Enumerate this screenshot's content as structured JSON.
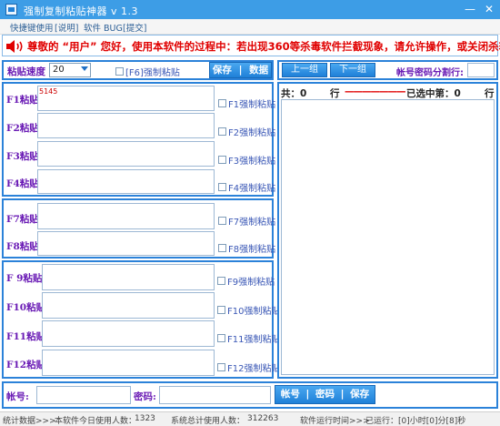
{
  "window": {
    "title": "强制复制粘贴神器 v 1.3",
    "controls": {
      "minimize": "—",
      "close": "✕"
    }
  },
  "menu": {
    "items": [
      "快捷键使用",
      "[说明]",
      "软件 BUG",
      "[提交]"
    ]
  },
  "notice": {
    "icon": "speaker-icon",
    "text": "尊敬的 “用户” 您好，使用本软件的过程中：若出现360等杀毒软件拦截现象，请允许操作，或关闭杀软！"
  },
  "speed": {
    "label": "粘贴速度",
    "value": "20",
    "force_label": "[F6]强制粘贴"
  },
  "toolbar": {
    "save": "保存",
    "data": "数据",
    "prev": "上一组",
    "next": "下一组",
    "separator_label": "帐号密码分割行:"
  },
  "paste_rows_group1": [
    {
      "label": "F1粘贴",
      "value": "5145",
      "force": "F1强制粘贴"
    },
    {
      "label": "F2粘贴",
      "value": "",
      "force": "F2强制粘贴"
    },
    {
      "label": "F3粘贴",
      "value": "",
      "force": "F3强制粘贴"
    },
    {
      "label": "F4粘贴",
      "value": "",
      "force": "F4强制粘贴"
    }
  ],
  "paste_rows_group2": [
    {
      "label": "F7粘贴",
      "value": "",
      "force": "F7强制粘贴"
    },
    {
      "label": "F8粘贴",
      "value": "",
      "force": "F8强制粘贴"
    }
  ],
  "paste_rows_group3": [
    {
      "label": "F 9粘贴",
      "value": "",
      "force": "F9强制粘贴"
    },
    {
      "label": "F10粘贴",
      "value": "",
      "force": "F10强制粘贴"
    },
    {
      "label": "F11粘贴",
      "value": "",
      "force": "F11强制粘贴"
    },
    {
      "label": "F12粘贴",
      "value": "",
      "force": "F12强制粘贴"
    }
  ],
  "list_header": {
    "total_label": "共：0",
    "row_label": "行",
    "dashes": "———————",
    "selected_label": "已选中第：0",
    "row_label2": "行"
  },
  "bottom": {
    "account_label": "帐号:",
    "password_label": "密码:",
    "account_btn": "帐号",
    "password_btn": "密码",
    "save_btn": "保存"
  },
  "status": {
    "stats": "统计数据>>>",
    "today_label": "本软件今日使用人数：",
    "today_value": "1323",
    "total_label": "系统总计使用人数：",
    "total_value": "312263",
    "runtime_label": "软件运行时间>>>",
    "runtime_value": "已运行：[0]小时[0]分[8]秒"
  },
  "colors": {
    "accent": "#2b82d9",
    "label_purple": "#6a1bb5",
    "notice_red": "#e00000"
  }
}
